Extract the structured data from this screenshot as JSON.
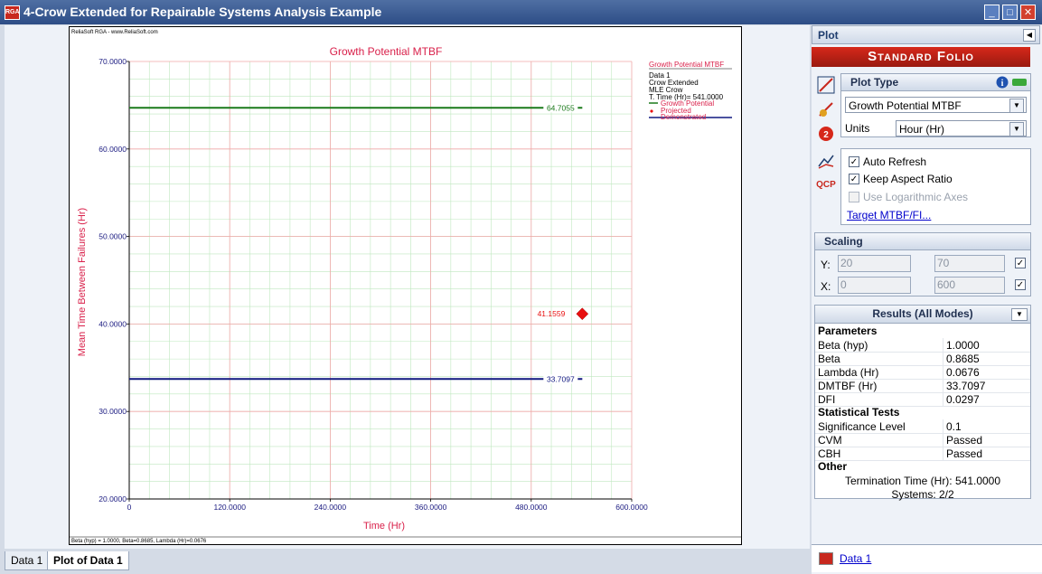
{
  "window": {
    "title": "4-Crow Extended for Repairable Systems Analysis Example"
  },
  "plot": {
    "watermark": "ReliaSoft RGA - www.ReliaSoft.com",
    "footer": "Beta (hyp) = 1.0000, Beta=0.8685, Lambda (Hr)=0.0676",
    "legend": {
      "title": "Growth Potential MTBF",
      "lines": [
        "Data 1",
        "Crow Extended",
        "MLE Crow",
        "T. Time (Hr)= 541.0000"
      ],
      "series": [
        "Growth Potential",
        "Projected",
        "Demonstrated"
      ]
    }
  },
  "chart_data": {
    "type": "line",
    "title": "Growth Potential MTBF",
    "xlabel": "Time (Hr)",
    "ylabel": "Mean Time Between Failures (Hr)",
    "xlim": [
      0,
      600
    ],
    "ylim": [
      20,
      70
    ],
    "x_ticks": [
      "0",
      "120.0000",
      "240.0000",
      "360.0000",
      "480.0000",
      "600.0000"
    ],
    "y_ticks": [
      "20.0000",
      "30.0000",
      "40.0000",
      "50.0000",
      "60.0000",
      "70.0000"
    ],
    "grid": true,
    "legend_position": "right",
    "series": [
      {
        "name": "Growth Potential",
        "x": [
          0,
          541
        ],
        "y": [
          64.7055,
          64.7055
        ],
        "label": "64.7055",
        "color": "#1a7a1a"
      },
      {
        "name": "Projected",
        "x": [
          541
        ],
        "y": [
          41.1559
        ],
        "label": "41.1559",
        "color": "#e81010",
        "marker": "diamond"
      },
      {
        "name": "Demonstrated",
        "x": [
          0,
          541
        ],
        "y": [
          33.7097,
          33.7097
        ],
        "label": "33.7097",
        "color": "#101880"
      }
    ]
  },
  "tabs": [
    {
      "label": "Data 1"
    },
    {
      "label": "Plot of Data 1"
    }
  ],
  "panel": {
    "header": "Plot",
    "folio": "Standard Folio",
    "plot_type": {
      "title": "Plot Type",
      "value": "Growth Potential MTBF",
      "units_label": "Units",
      "units_value": "Hour (Hr)"
    },
    "options": {
      "auto_refresh": "Auto Refresh",
      "keep_aspect": "Keep Aspect Ratio",
      "log_axes": "Use Logarithmic Axes",
      "target_link": "Target MTBF/FI..."
    },
    "scaling": {
      "title": "Scaling",
      "y_label": "Y:",
      "y_min": "20",
      "y_max": "70",
      "x_label": "X:",
      "x_min": "0",
      "x_max": "600"
    },
    "results": {
      "title": "Results (All Modes)",
      "parameters_title": "Parameters",
      "parameters": [
        {
          "k": "Beta (hyp)",
          "v": "1.0000"
        },
        {
          "k": "Beta",
          "v": "0.8685"
        },
        {
          "k": "Lambda (Hr)",
          "v": "0.0676"
        },
        {
          "k": "DMTBF (Hr)",
          "v": "33.7097"
        },
        {
          "k": "DFI",
          "v": "0.0297"
        }
      ],
      "tests_title": "Statistical Tests",
      "tests": [
        {
          "k": "Significance Level",
          "v": "0.1"
        },
        {
          "k": "CVM",
          "v": "Passed"
        },
        {
          "k": "CBH",
          "v": "Passed"
        }
      ],
      "other_title": "Other",
      "termination": "Termination Time (Hr): 541.0000",
      "systems": "Systems: 2/2"
    },
    "bottom_link": "Data 1"
  }
}
